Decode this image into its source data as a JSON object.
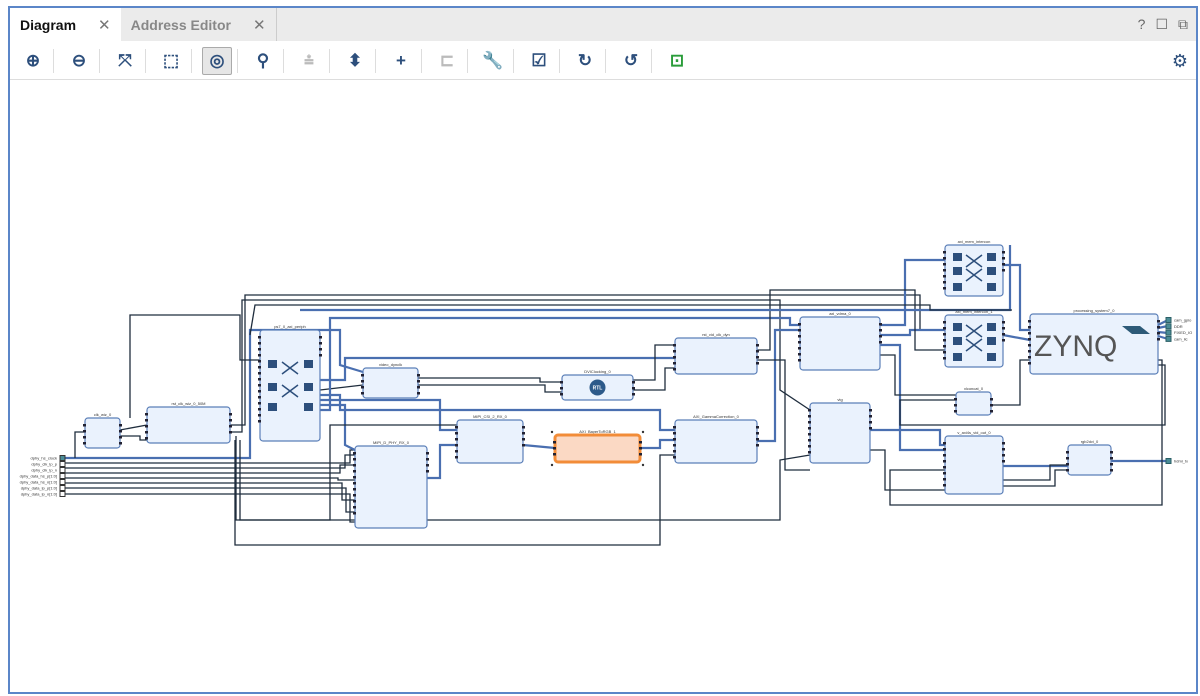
{
  "tabs": [
    {
      "label": "Diagram",
      "active": true
    },
    {
      "label": "Address Editor",
      "active": false
    }
  ],
  "window_buttons": {
    "help": "?",
    "restore": "☐",
    "float": "⧉"
  },
  "toolbar": [
    {
      "icon": "zoom-in-icon",
      "glyph": "⊕"
    },
    {
      "icon": "zoom-out-icon",
      "glyph": "⊖"
    },
    {
      "icon": "zoom-fit-icon",
      "glyph": "⤧"
    },
    {
      "icon": "zoom-area-icon",
      "glyph": "⬚"
    },
    {
      "icon": "auto-fit-selection-icon",
      "glyph": "◎",
      "selected": true
    },
    {
      "icon": "search-icon",
      "glyph": "⚲"
    },
    {
      "icon": "collapse-all-icon",
      "glyph": "⩮",
      "disabled": true
    },
    {
      "icon": "expand-all-icon",
      "glyph": "⬍"
    },
    {
      "icon": "add-ip-icon",
      "glyph": "+"
    },
    {
      "icon": "make-connection-icon",
      "glyph": "⊏",
      "disabled": true
    },
    {
      "icon": "customize-wrench-icon",
      "glyph": "🔧"
    },
    {
      "icon": "validate-design-icon",
      "glyph": "☑"
    },
    {
      "icon": "refresh-icon",
      "glyph": "↻"
    },
    {
      "icon": "regenerate-layout-icon",
      "glyph": "↺"
    },
    {
      "icon": "add-module-icon",
      "glyph": "⊡"
    }
  ],
  "settings_icon": "⚙",
  "colors": {
    "accent": "#5b86c8",
    "block_fill": "#eaf2fd",
    "block_stroke": "#5b7fb8",
    "bus": "#4a6fb0",
    "wire": "#1f2d3d",
    "selected": "#f28c38",
    "selected_fill": "#fbd9c4"
  },
  "diagram": {
    "blocks": [
      {
        "name": "clk_wiz_0"
      },
      {
        "name": "rst_clk_wiz_0_50M"
      },
      {
        "name": "ps7_0_axi_periph"
      },
      {
        "name": "video_dynclk"
      },
      {
        "name": "MIPI_D_PHY_RX_0"
      },
      {
        "name": "MIPI_CSI_2_RX_0"
      },
      {
        "name": "AXI_BayerToRGB_1",
        "selected": true
      },
      {
        "name": "DVIClocking_0",
        "badge": "RTL"
      },
      {
        "name": "rst_vid_clk_dyn"
      },
      {
        "name": "AXI_GammaCorrection_0"
      },
      {
        "name": "axi_vdma_0"
      },
      {
        "name": "vtg"
      },
      {
        "name": "axi_mem_intercon"
      },
      {
        "name": "axi_mem_intercon_1"
      },
      {
        "name": "processing_system7_0",
        "logo": "ZYNQ"
      },
      {
        "name": "xlconcat_0"
      },
      {
        "name": "v_axi4s_vid_out_0"
      },
      {
        "name": "rgb2dvi_0"
      }
    ],
    "input_ports": [
      "dphy_hs_clock",
      "dphy_clk_lp_p",
      "dphy_clk_lp_n",
      "dphy_data_hs_p[1:0]",
      "dphy_data_hs_n[1:0]",
      "dphy_data_lp_p[1:0]",
      "dphy_data_lp_n[1:0]"
    ],
    "output_ports": [
      "cam_gpio",
      "DDR",
      "FIXED_IO",
      "cam_iic",
      "hdmi_tx"
    ]
  }
}
